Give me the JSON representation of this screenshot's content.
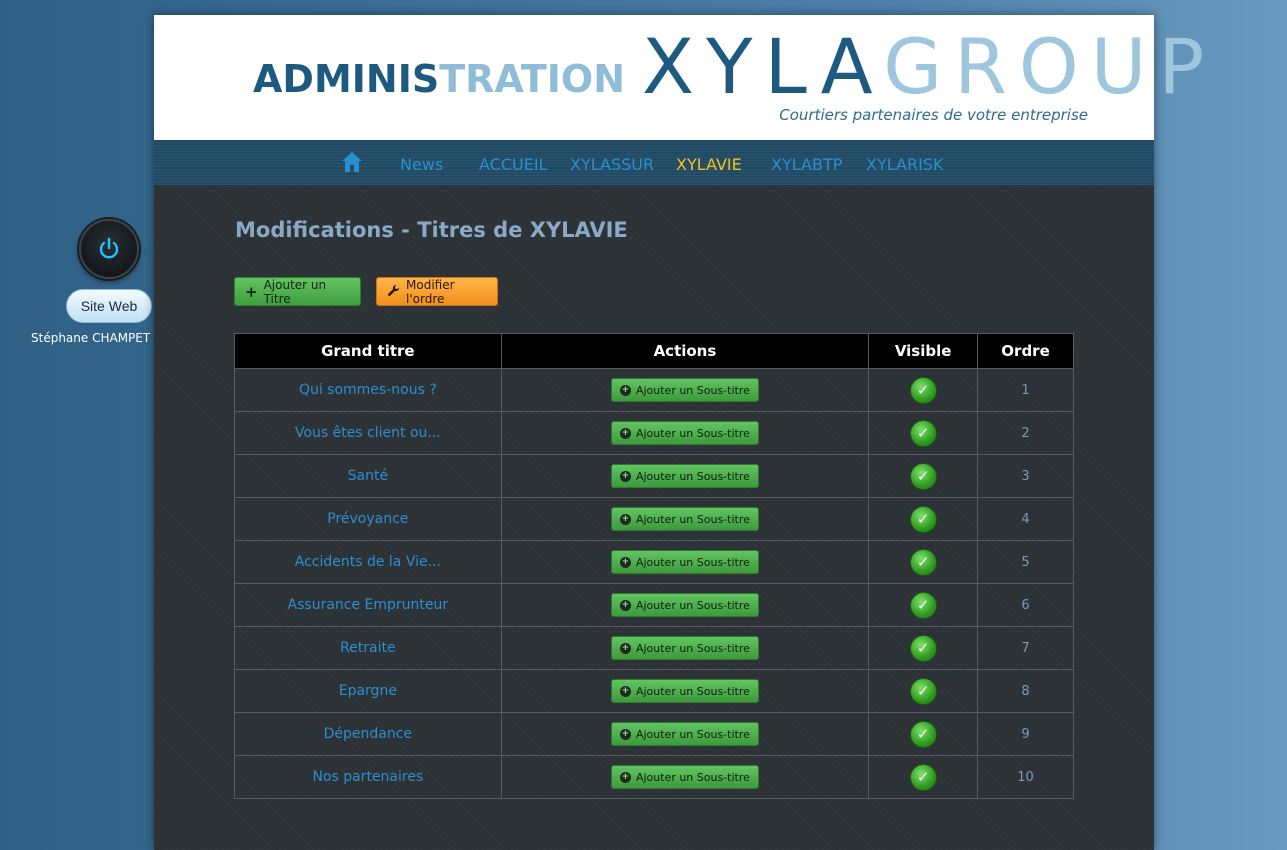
{
  "sidebar": {
    "power_icon": "power-icon",
    "site_web_label": "Site Web",
    "user_name": "Stéphane CHAMPET"
  },
  "header": {
    "admin_part1": "ADMINIS",
    "admin_part2": "TRATION",
    "logo_part1": "XYLA",
    "logo_part2": "GROUP",
    "tagline": "Courtiers partenaires de votre entreprise"
  },
  "nav": {
    "home_icon": "home-icon",
    "items": [
      {
        "label": "News",
        "active": false
      },
      {
        "label": "ACCUEIL",
        "active": false
      },
      {
        "label": "XYLASSUR",
        "active": false
      },
      {
        "label": "XYLAVIE",
        "active": true
      },
      {
        "label": "XYLABTP",
        "active": false
      },
      {
        "label": "XYLARISK",
        "active": false
      }
    ]
  },
  "page": {
    "title": "Modifications - Titres de XYLAVIE",
    "add_title_label": "Ajouter un Titre",
    "modify_order_label": "Modifier l'ordre"
  },
  "table": {
    "headers": [
      "Grand titre",
      "Actions",
      "Visible",
      "Ordre"
    ],
    "action_label": "Ajouter un Sous-titre",
    "rows": [
      {
        "title": "Qui sommes-nous ?",
        "visible": true,
        "order": "1"
      },
      {
        "title": "Vous êtes client ou...",
        "visible": true,
        "order": "2"
      },
      {
        "title": "Santé",
        "visible": true,
        "order": "3"
      },
      {
        "title": "Prévoyance",
        "visible": true,
        "order": "4"
      },
      {
        "title": "Accidents de la Vie...",
        "visible": true,
        "order": "5"
      },
      {
        "title": "Assurance Emprunteur",
        "visible": true,
        "order": "6"
      },
      {
        "title": "Retraite",
        "visible": true,
        "order": "7"
      },
      {
        "title": "Epargne",
        "visible": true,
        "order": "8"
      },
      {
        "title": "Dépendance",
        "visible": true,
        "order": "9"
      },
      {
        "title": "Nos partenaires",
        "visible": true,
        "order": "10"
      }
    ]
  },
  "colors": {
    "accent_blue": "#2a8fd0",
    "active_nav": "#f6c21a",
    "green_button": "#4caf50",
    "orange_button": "#f7a02c"
  }
}
